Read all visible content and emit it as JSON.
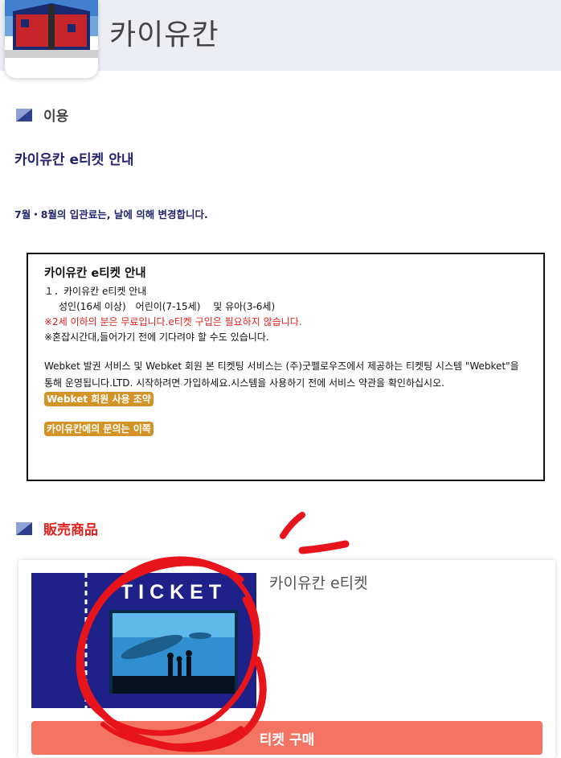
{
  "header": {
    "title": "카이유칸"
  },
  "sections": {
    "usage": {
      "label": "이용"
    },
    "products": {
      "label": "販売商品"
    }
  },
  "guide": {
    "title": "카이유칸 e티켓 안내",
    "notice": "7월・8월의 입관료는, 날에 의해 변경합니다."
  },
  "info_box": {
    "title": "카이유칸 e티켓 안내",
    "line1": "１．카이유칸 e티켓 안내",
    "line2": "성인(16세 이상)　어린이(7-15세)　 및 유아(3-6세)",
    "line3": "※2세 이하의 분은 무료입니다.e티켓 구입은 필요하지 않습니다.",
    "line4": "※혼잡시간대,들어가기 전에 기다려야 할 수도 있습니다.",
    "para": "Webket 발권 서비스 및 Webket 회원 본 티켓팅 서비스는 (주)굿펠로우즈에서 제공하는 티켓팅 시스템 \"Webket\"을 통해 운영됩니다.LTD. 시작하려면 가입하세요.시스템을 사용하기 전에 서비스 약관을 확인하십시오.",
    "terms_link": "Webket 회원 사용 조약",
    "contact_link": "카이유칸에의 문의는 이쪽"
  },
  "product": {
    "ticket_word": "TICKET",
    "name": "카이유칸 e티켓",
    "buy_label": "티켓 구매"
  },
  "colors": {
    "header_bg": "#eceef4",
    "navy_text": "#23236e",
    "red_text": "#e0201e",
    "pill": "#d49327",
    "buy_button": "#f47464",
    "ticket_bg": "#1e2288",
    "scribble": "#e8141c"
  },
  "icons": [
    "logo-image",
    "section-flag-icon",
    "aquarium-photo"
  ]
}
